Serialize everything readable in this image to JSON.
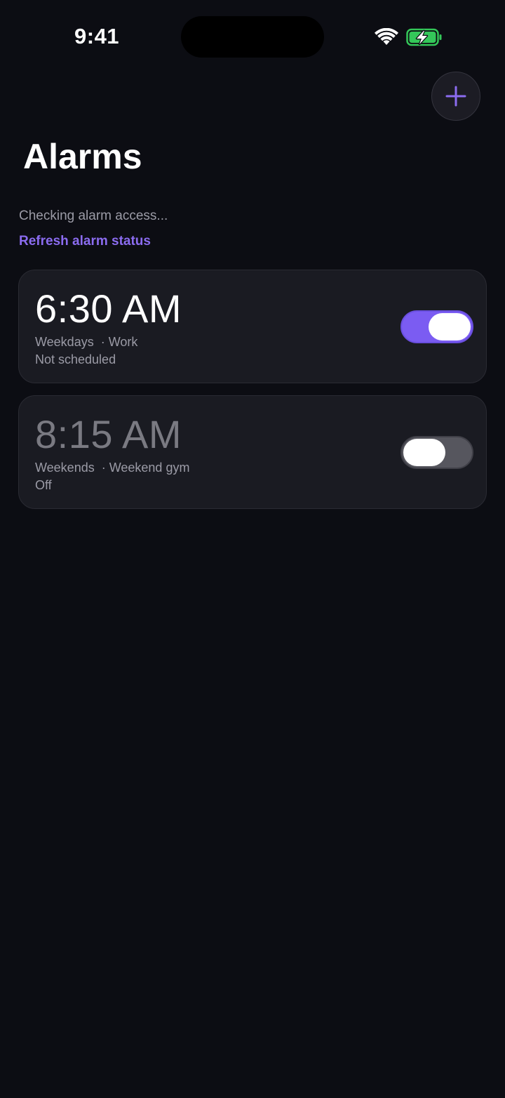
{
  "status_bar": {
    "time": "9:41"
  },
  "header": {
    "add_button_icon": "plus-icon",
    "title": "Alarms"
  },
  "access": {
    "status_text": "Checking alarm access...",
    "refresh_label": "Refresh alarm status"
  },
  "alarms": [
    {
      "time": "6:30 AM",
      "schedule": "Weekdays",
      "label": "Work",
      "separator": "  · ",
      "state": "Not scheduled",
      "enabled": true
    },
    {
      "time": "8:15 AM",
      "schedule": "Weekends",
      "label": "Weekend gym",
      "separator": "  · ",
      "state": "Off",
      "enabled": false
    }
  ],
  "colors": {
    "background": "#0c0d13",
    "card": "#1a1b22",
    "accent": "#7b5cf2",
    "link": "#8b6cf0",
    "battery_charging": "#34c759"
  }
}
